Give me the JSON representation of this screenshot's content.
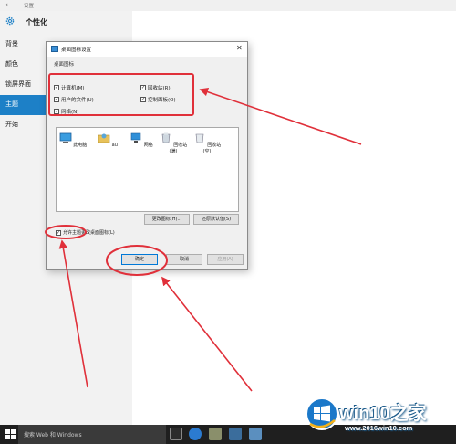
{
  "window": {
    "title": "设置",
    "back_glyph": "←"
  },
  "settings": {
    "header": "个性化",
    "nav": [
      "背景",
      "颜色",
      "锁屏界面",
      "主题",
      "开始"
    ],
    "active_index": 3
  },
  "dialog": {
    "title": "桌面图标设置",
    "close_glyph": "✕",
    "group_title": "桌面图标",
    "checkboxes": [
      {
        "label": "计算机(M)",
        "checked": true
      },
      {
        "label": "回收站(R)",
        "checked": true
      },
      {
        "label": "用户的文件(U)",
        "checked": true
      },
      {
        "label": "控制面板(O)",
        "checked": true
      },
      {
        "label": "网络(N)",
        "checked": true
      }
    ],
    "desktop_icons": [
      "此电脑",
      "au",
      "网络",
      "回收站(满)",
      "回收站(空)"
    ],
    "change_icon_button": "更改图标(H)...",
    "restore_default_button": "还原默认值(S)",
    "allow_themes_label": "允许主题更改桌面图标(L)",
    "allow_themes_checked": true,
    "ok_button": "确定",
    "cancel_button": "取消",
    "apply_button": "应用(A)"
  },
  "taskbar": {
    "search_placeholder": "搜索 Web 和 Windows"
  },
  "watermark": {
    "brand": "win10之家",
    "url": "www.2016win10.com"
  },
  "colors": {
    "accent": "#1d80c7",
    "annotation_red": "#e0303a",
    "taskbar": "#1f1f1f"
  }
}
